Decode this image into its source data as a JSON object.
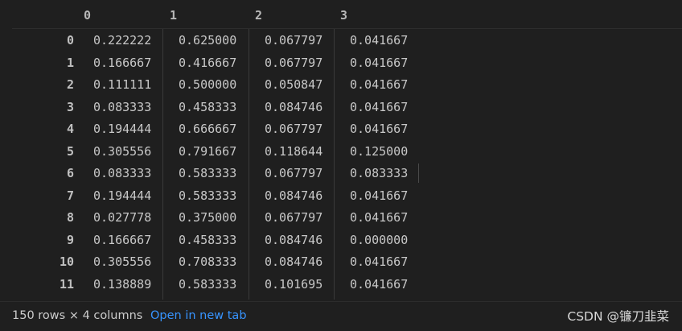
{
  "table": {
    "columns": [
      "0",
      "1",
      "2",
      "3"
    ],
    "rows": [
      {
        "index": "0",
        "values": [
          "0.222222",
          "0.625000",
          "0.067797",
          "0.041667"
        ]
      },
      {
        "index": "1",
        "values": [
          "0.166667",
          "0.416667",
          "0.067797",
          "0.041667"
        ]
      },
      {
        "index": "2",
        "values": [
          "0.111111",
          "0.500000",
          "0.050847",
          "0.041667"
        ]
      },
      {
        "index": "3",
        "values": [
          "0.083333",
          "0.458333",
          "0.084746",
          "0.041667"
        ]
      },
      {
        "index": "4",
        "values": [
          "0.194444",
          "0.666667",
          "0.067797",
          "0.041667"
        ]
      },
      {
        "index": "5",
        "values": [
          "0.305556",
          "0.791667",
          "0.118644",
          "0.125000"
        ]
      },
      {
        "index": "6",
        "values": [
          "0.083333",
          "0.583333",
          "0.067797",
          "0.083333"
        ]
      },
      {
        "index": "7",
        "values": [
          "0.194444",
          "0.583333",
          "0.084746",
          "0.041667"
        ]
      },
      {
        "index": "8",
        "values": [
          "0.027778",
          "0.375000",
          "0.067797",
          "0.041667"
        ]
      },
      {
        "index": "9",
        "values": [
          "0.166667",
          "0.458333",
          "0.084746",
          "0.000000"
        ]
      },
      {
        "index": "10",
        "values": [
          "0.305556",
          "0.708333",
          "0.084746",
          "0.041667"
        ]
      },
      {
        "index": "11",
        "values": [
          "0.138889",
          "0.583333",
          "0.101695",
          "0.041667"
        ]
      }
    ]
  },
  "footer": {
    "summary": "150 rows × 4 columns",
    "open_link": "Open in new tab"
  },
  "watermark": "CSDN @镰刀韭菜",
  "colors": {
    "background": "#1f1f1f",
    "text": "#cccccc",
    "link": "#3794ff",
    "divider": "#3a3a3a"
  }
}
